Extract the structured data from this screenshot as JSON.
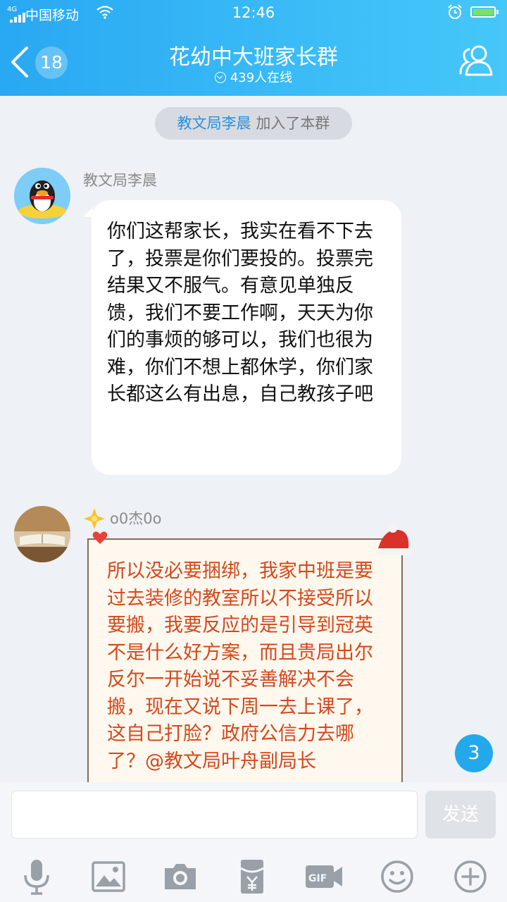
{
  "status_bar": {
    "network": "4G",
    "carrier": "中国移动",
    "time": "12:46"
  },
  "header": {
    "back_count": "18",
    "title": "花幼中大班家长群",
    "online": "439人在线"
  },
  "system_message": {
    "who": "教文局李晨",
    "action": " 加入了本群"
  },
  "messages": [
    {
      "sender": "教文局李晨",
      "text": "你们这帮家长，我实在看不下去了，投票是你们要投的。投票完结果又不服气。有意见单独反馈，我们不要工作啊，天天为你们的事烦的够可以，我们也很为难，你们不想上都休学，你们家长都这么有出息，自己教孩子吧"
    },
    {
      "sender": "o0杰0o",
      "text": "所以没必要捆绑，我家中班是要过去装修的教室所以不接受所以要搬，我要反应的是引导到冠英不是什么好方案，而且贵局出尔反尔一开始说不妥善解决不会搬，现在又说下周一去上课了，这自己打脸？政府公信力去哪了？@教文局叶舟副局长"
    }
  ],
  "unread_count": "3",
  "input": {
    "value": "",
    "send_label": "发送"
  },
  "toolbar": [
    "mic-icon",
    "image-icon",
    "camera-icon",
    "red-packet-icon",
    "gif-icon",
    "emoji-icon",
    "plus-icon"
  ],
  "colors": {
    "header": "#2aa9f2",
    "link_name": "#2d8ed8",
    "reply_text": "#d3481c",
    "unread_badge": "#24a8ec"
  }
}
